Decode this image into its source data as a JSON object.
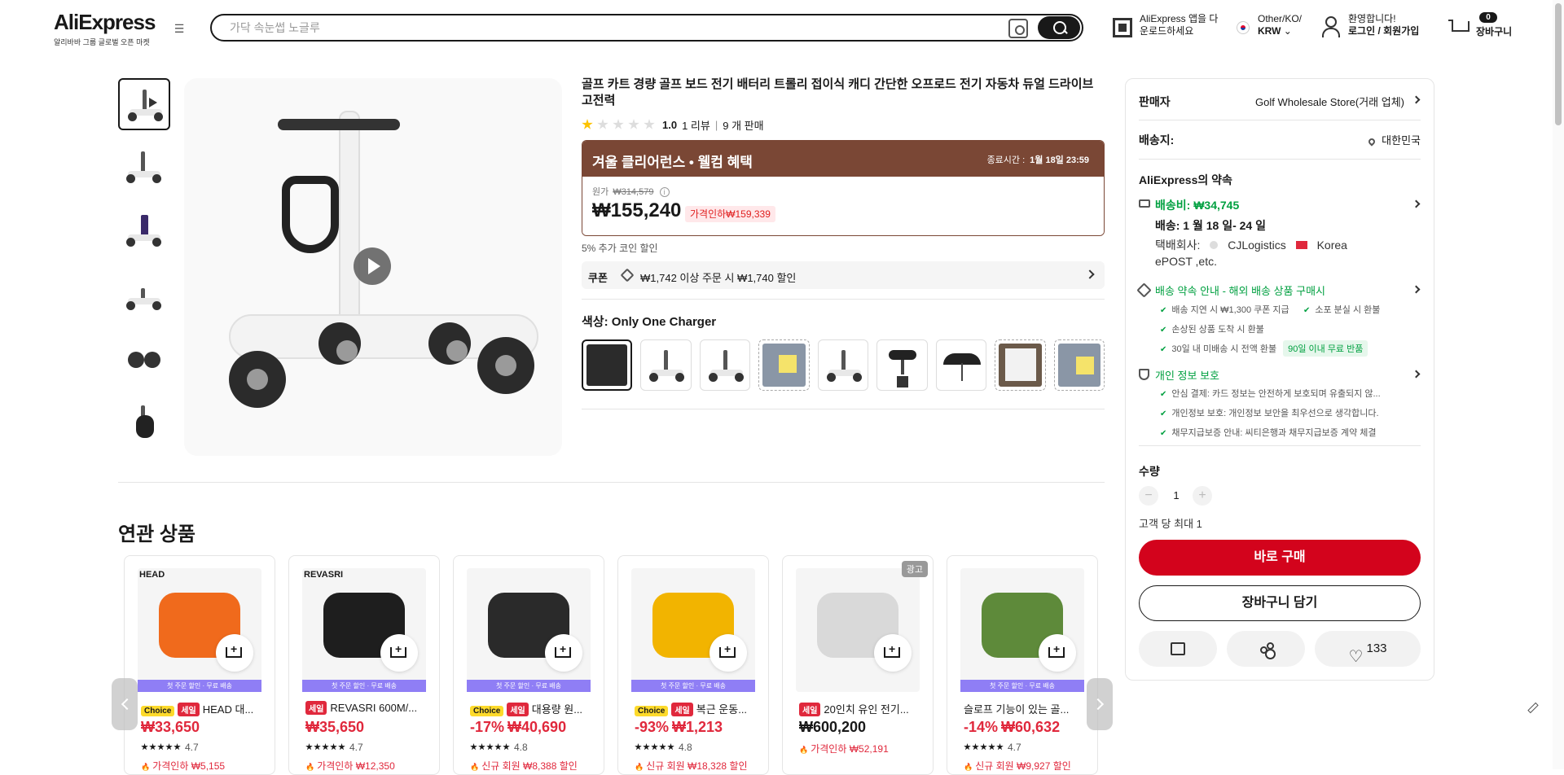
{
  "header": {
    "logo": "AliExpress",
    "logo_sub": "알리바바 그룹 글로벌 오픈 마켓",
    "search_placeholder": "가닥 속눈썹 노글루",
    "app_line1": "AliExpress 앱을 다",
    "app_line2": "운로드하세요",
    "region_line1": "Other/KO/",
    "region_line2": "KRW",
    "user_line1": "환영합니다!",
    "user_line2": "로그인 / 회원가입",
    "cart_count": "0",
    "cart_label": "장바구니"
  },
  "product": {
    "title": "골프 카트 경량 골프 보드 전기 배터리 트롤리 접이식 캐디 간단한 오프로드 전기 자동차 듀얼 드라이브 고전력",
    "rating": 1.0,
    "rating_text": "1.0",
    "reviews": "1 리뷰",
    "sold": "9 개 판매",
    "promo_title": "겨울 클리어런스 • 웰컴 혜택",
    "promo_end_label": "종료시간 :",
    "promo_end_time": "1월 18일 23:59",
    "original_label": "원가",
    "original_price": "₩314,579",
    "price": "₩155,240",
    "discount": "가격인하₩159,339",
    "coin_text": "5% 추가 코인 할인",
    "coupon_label": "쿠폰",
    "coupon_text": "₩1,742 이상 주문 시 ₩1,740 할인",
    "color_label": "색상:",
    "color_value": "Only One Charger",
    "swatches": [
      "charger",
      "scooter",
      "scooter-bag",
      "note",
      "scooter-2",
      "seat",
      "umbrella",
      "doc",
      "note-2"
    ]
  },
  "panel": {
    "seller_label": "판매자",
    "seller_name": "Golf Wholesale Store(거래 업체)",
    "ship_to_label": "배송지:",
    "ship_to": "대한민국",
    "promise_title": "AliExpress의 약속",
    "shipping_fee": "배송비: ₩34,745",
    "delivery": "배송: 1 월 18 일- 24 일",
    "carrier_line1": "택배회사:",
    "carrier_1": "CJLogistics",
    "carrier_2": "Korea",
    "carrier_line2": "ePOST ,etc.",
    "guarantee_title": "배송 약속 안내 - 해외 배송 상품 구매시",
    "guarantee_items": [
      "배송 지연 시 ₩1,300 쿠폰 지급",
      "소포 분실 시 환불",
      "손상된 상품 도착 시 환불",
      "30일 내 미배송 시 전액 환불"
    ],
    "returns_badge": "90일 이내 무료 반품",
    "privacy_title": "개인 정보 보호",
    "privacy_items": [
      "안심 결제: 카드 정보는 안전하게 보호되며 유출되지 않...",
      "개인정보 보호: 개인정보 보안을 최우선으로 생각합니다.",
      "채무지급보증 안내: 씨티은행과 채무지급보증 계약 체결"
    ],
    "qty_label": "수량",
    "qty_minus": "−",
    "qty_value": "1",
    "qty_plus": "+",
    "qty_limit": "고객 당 최대 1",
    "buy_now": "바로 구매",
    "add_to_cart": "장바구니 담기",
    "wishlist_count": "133"
  },
  "related": {
    "title": "연관 상품",
    "strip_text": "첫 주문 할인 · 무료 배송",
    "ad_label": "광고",
    "items": [
      {
        "badges": [
          "Choice",
          "세일"
        ],
        "name": "HEAD 대...",
        "discount": "",
        "price": "₩33,650",
        "rating": "4.7",
        "promo": "가격인하 ₩5,155",
        "brand": "HEAD",
        "color": "#f06a1c",
        "strip": true,
        "ad": false
      },
      {
        "badges": [
          "세일"
        ],
        "name": "REVASRI 600M/...",
        "discount": "",
        "price": "₩35,650",
        "rating": "4.7",
        "promo": "가격인하 ₩12,350",
        "brand": "REVASRI",
        "color": "#1e1e1e",
        "strip": true,
        "ad": false
      },
      {
        "badges": [
          "Choice",
          "세일"
        ],
        "name": "대용량 원...",
        "discount": "-17%",
        "price": "₩40,690",
        "rating": "4.8",
        "promo": "신규 회원 ₩8,388 할인",
        "brand": "",
        "color": "#2a2a2a",
        "strip": true,
        "ad": false
      },
      {
        "badges": [
          "Choice",
          "세일"
        ],
        "name": "복근 운동...",
        "discount": "-93%",
        "price": "₩1,213",
        "rating": "4.8",
        "promo": "신규 회원 ₩18,328 할인",
        "brand": "",
        "color": "#f2b400",
        "strip": true,
        "ad": false
      },
      {
        "badges": [
          "세일"
        ],
        "name": "20인치 유인 전기...",
        "discount": "",
        "price": "₩600,200",
        "rating": "",
        "promo": "가격인하 ₩52,191",
        "brand": "",
        "color": "#d9d9d9",
        "strip": false,
        "ad": true
      },
      {
        "badges": [],
        "name": "슬로프 기능이 있는 골...",
        "discount": "-14%",
        "price": "₩60,632",
        "rating": "4.7",
        "promo": "신규 회원 ₩9,927 할인",
        "brand": "",
        "color": "#5e8a3a",
        "strip": true,
        "ad": false
      }
    ]
  }
}
